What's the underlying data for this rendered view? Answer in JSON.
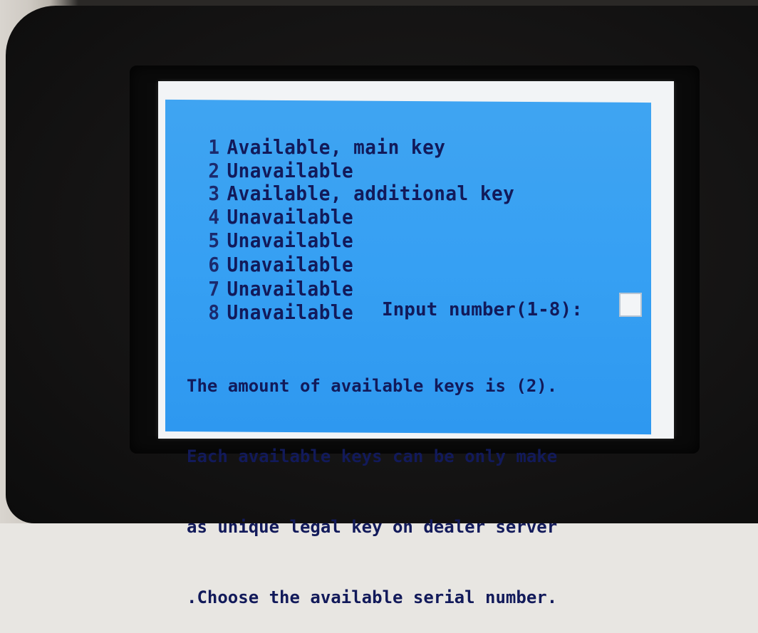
{
  "keys": [
    {
      "num": "1",
      "status": "Available, main key"
    },
    {
      "num": "2",
      "status": "Unavailable"
    },
    {
      "num": "3",
      "status": "Available, additional key"
    },
    {
      "num": "4",
      "status": "Unavailable"
    },
    {
      "num": "5",
      "status": "Unavailable"
    },
    {
      "num": "6",
      "status": "Unavailable"
    },
    {
      "num": "7",
      "status": "Unavailable"
    },
    {
      "num": "8",
      "status": "Unavailable"
    }
  ],
  "prompt": {
    "label": "Input number(1-8):",
    "value": ""
  },
  "message": {
    "line1": "The amount of available keys is (2).",
    "line2": "Each available keys can be only make",
    "line3": "as unique legal key on dealer server",
    "line4": ".Choose the available serial number."
  },
  "colors": {
    "screen_background": "#36a0f3",
    "text": "#121a5a",
    "frame": "#f2f4f6"
  }
}
